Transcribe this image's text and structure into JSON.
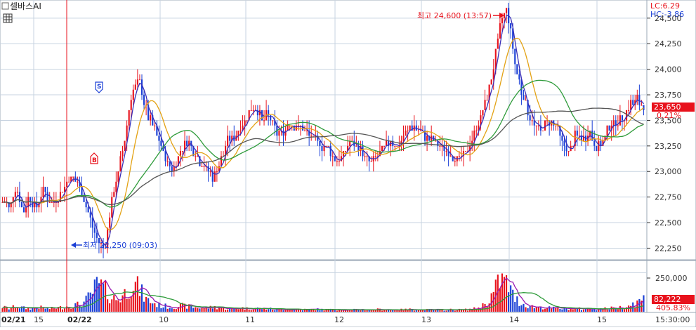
{
  "chart_title": "셀바스AI",
  "indicators": {
    "lc": "LC:6.29",
    "hc": "HC:-3.86"
  },
  "colors": {
    "up": "#e8121c",
    "down": "#1a3fd6",
    "ma_short": "#e3a214",
    "ma_mid": "#2e9b3a",
    "ma_long": "#555555",
    "ma_fast": "#3a2fb8",
    "vol_ma": "#9a1ab0",
    "grid": "#c7d3e0",
    "axis_bg": "#ffffff",
    "price_tag": "#e8121c"
  },
  "annotations": {
    "high_label": "최고 24,600 (13:57)",
    "low_label": "최저 22,250 (09:03)",
    "sell_marker": "S",
    "buy_marker": "B"
  },
  "price_axis": {
    "ticks": [
      "24,500",
      "24,250",
      "24,000",
      "23,750",
      "23,500",
      "23,250",
      "23,000",
      "22,750",
      "22,500",
      "22,250"
    ],
    "current_price": "23,650",
    "change_pct": "0.21%"
  },
  "volume_axis": {
    "tick": "250,000",
    "current_volume": "82,222",
    "volume_pct": "405.83%"
  },
  "time_axis": {
    "labels": [
      "02/21",
      "15",
      "02/22",
      "10",
      "11",
      "12",
      "13",
      "14",
      "15"
    ],
    "cursor_time": "15:30:00"
  },
  "chart_data": {
    "type": "candlestick",
    "symbol": "셀바스AI",
    "ylim": [
      22150,
      24650
    ],
    "y_ticks": [
      22250,
      22500,
      22750,
      23000,
      23250,
      23500,
      23750,
      24000,
      24250,
      24500
    ],
    "volume_ylim": [
      0,
      320000
    ],
    "volume_ticks": [
      250000
    ],
    "x_labels": [
      "02/21",
      "15",
      "02/22",
      "10",
      "11",
      "12",
      "13",
      "14",
      "15"
    ],
    "high": {
      "value": 24600,
      "time": "13:57"
    },
    "low": {
      "value": 22250,
      "time": "09:03"
    },
    "last_price": 23650,
    "change_pct": 0.21,
    "last_volume": 82222,
    "volume_change_pct": 405.83,
    "price_path": [
      22700,
      22650,
      22850,
      22600,
      22750,
      22650,
      22800,
      22700,
      22750,
      22850,
      22950,
      22900,
      22700,
      22500,
      22300,
      22250,
      22700,
      23000,
      23350,
      23800,
      23900,
      23600,
      23450,
      23300,
      23100,
      23000,
      23200,
      23300,
      23200,
      23100,
      23000,
      22950,
      23100,
      23300,
      23350,
      23450,
      23550,
      23650,
      23500,
      23550,
      23400,
      23350,
      23500,
      23450,
      23400,
      23350,
      23300,
      23250,
      23200,
      23100,
      23150,
      23300,
      23250,
      23150,
      23100,
      23150,
      23250,
      23300,
      23250,
      23350,
      23450,
      23400,
      23350,
      23300,
      23250,
      23200,
      23150,
      23100,
      23200,
      23350,
      23500,
      23700,
      24000,
      24450,
      24600,
      24100,
      23800,
      23600,
      23450,
      23400,
      23500,
      23450,
      23300,
      23200,
      23350,
      23300,
      23400,
      23250,
      23300,
      23450,
      23500,
      23550,
      23650,
      23700,
      23650
    ],
    "volume_path": [
      30000,
      20000,
      35000,
      25000,
      20000,
      30000,
      25000,
      20000,
      25000,
      30000,
      40000,
      45000,
      60000,
      110000,
      180000,
      140000,
      90000,
      80000,
      120000,
      190000,
      150000,
      80000,
      60000,
      40000,
      35000,
      30000,
      40000,
      35000,
      30000,
      25000,
      25000,
      30000,
      25000,
      20000,
      20000,
      25000,
      20000,
      25000,
      20000,
      20000,
      15000,
      15000,
      18000,
      15000,
      14000,
      15000,
      16000,
      14000,
      13000,
      15000,
      14000,
      12000,
      13000,
      14000,
      12000,
      15000,
      14000,
      13000,
      12000,
      14000,
      16000,
      14000,
      13000,
      12000,
      12000,
      13000,
      14000,
      13000,
      14000,
      18000,
      28000,
      60000,
      120000,
      210000,
      180000,
      90000,
      55000,
      40000,
      30000,
      28000,
      25000,
      22000,
      20000,
      22000,
      20000,
      18000,
      20000,
      18000,
      20000,
      22000,
      25000,
      30000,
      45000,
      60000,
      82222
    ]
  }
}
